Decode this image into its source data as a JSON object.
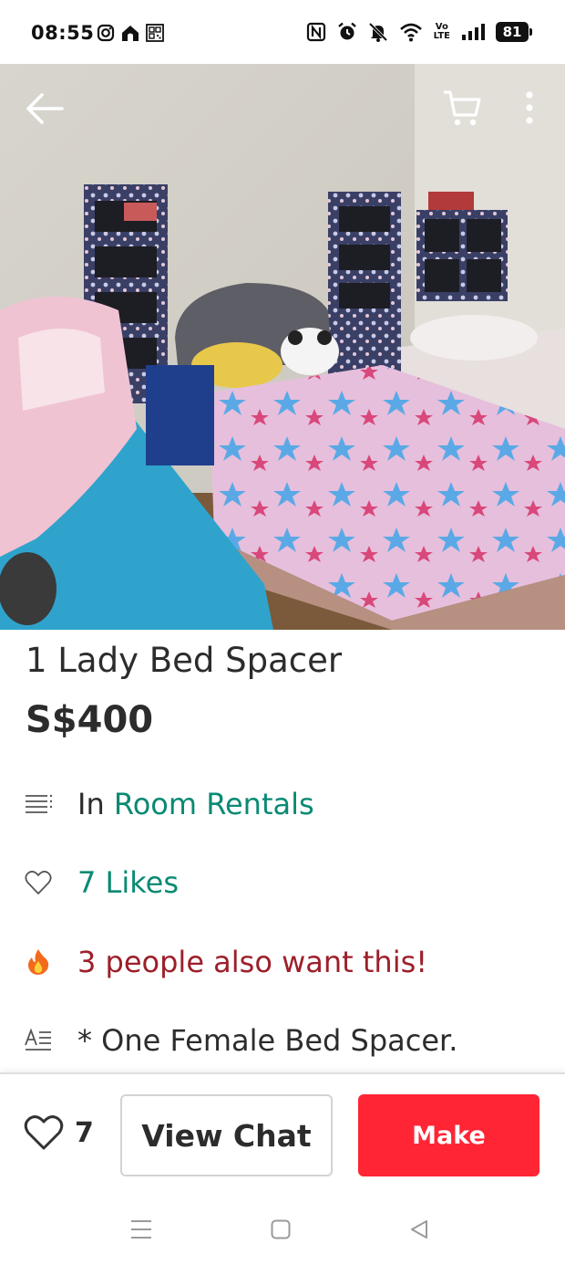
{
  "status_bar": {
    "time": "08:55",
    "battery": "81",
    "left_icons": [
      "instagram-icon",
      "home-app-icon",
      "qr-code-icon"
    ],
    "right_icons": [
      "nfc-icon",
      "alarm-icon",
      "mute-icon",
      "wifi-icon",
      "volte-icon",
      "signal-icon",
      "battery-icon"
    ],
    "volte_top": "Vo",
    "volte_bottom": "LTE"
  },
  "photo": {
    "description_icons": [
      "back-arrow-icon",
      "cart-icon",
      "more-vertical-icon"
    ]
  },
  "listing": {
    "title": "1 Lady Bed Spacer",
    "price": "S$400",
    "category_prefix": "In",
    "category": "Room Rentals",
    "likes": "7 Likes",
    "interest": "3 people also want this!",
    "description": "* One Female Bed Spacer."
  },
  "action_bar": {
    "like_count": "7",
    "chat_label": "View Chat",
    "make_label": "Make"
  },
  "colors": {
    "accent_teal": "#0a8a73",
    "maroon": "#9c1f2a",
    "make_red": "#ff2535"
  }
}
